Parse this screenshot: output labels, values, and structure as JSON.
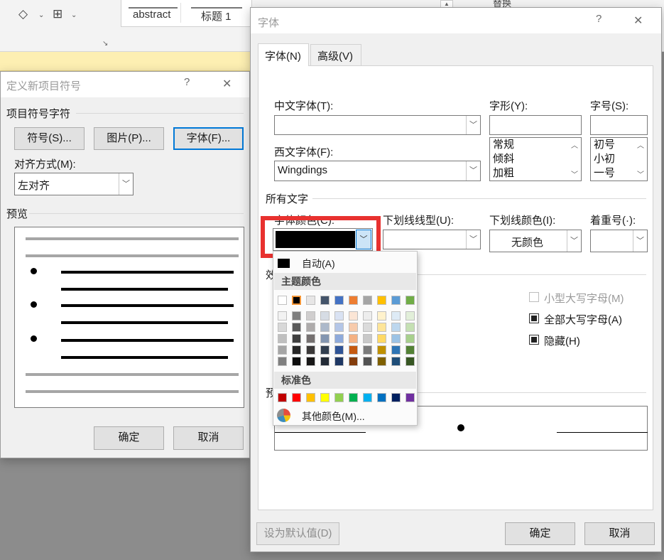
{
  "ribbon": {
    "styles": [
      "abstract",
      "标题 1"
    ],
    "right_label": "替换"
  },
  "bullet_dialog": {
    "title": "定义新项目符号",
    "help": "?",
    "close": "✕",
    "group_label": "项目符号字符",
    "symbol_button": "符号(S)...",
    "picture_button": "图片(P)...",
    "font_button": "字体(F)...",
    "align_label": "对齐方式(M):",
    "align_value": "左对齐",
    "preview_label": "预览",
    "ok": "确定",
    "cancel": "取消"
  },
  "font_dialog": {
    "title": "字体",
    "help": "?",
    "close": "✕",
    "tabs": [
      "字体(N)",
      "高级(V)"
    ],
    "chinese_font_label": "中文字体(T):",
    "chinese_font_value": "",
    "western_font_label": "西文字体(F):",
    "western_font_value": "Wingdings",
    "style_label": "字形(Y):",
    "style_value": "",
    "style_items": [
      "常规",
      "倾斜",
      "加粗"
    ],
    "size_label": "字号(S):",
    "size_value": "",
    "size_items": [
      "初号",
      "小初",
      "一号"
    ],
    "all_text_label": "所有文字",
    "font_color_label": "字体颜色(C):",
    "font_color_value": "#000000",
    "underline_style_label": "下划线线型(U):",
    "underline_style_value": "",
    "underline_color_label": "下划线颜色(I):",
    "underline_color_value": "无颜色",
    "emphasis_label": "着重号(·):",
    "emphasis_value": "",
    "effects_label": "效果",
    "effects": [
      {
        "label": "小型大写字母(M)",
        "checked": false,
        "enabled": false
      },
      {
        "label": "全部大写字母(A)",
        "checked": true,
        "enabled": true
      },
      {
        "label": "隐藏(H)",
        "checked": true,
        "enabled": true
      }
    ],
    "preview_label": "预览",
    "set_default": "设为默认值(D)",
    "ok": "确定",
    "cancel": "取消"
  },
  "color_popup": {
    "auto_label": "自动(A)",
    "theme_header": "主题颜色",
    "standard_header": "标准色",
    "more_colors": "其他颜色(M)...",
    "theme_top": [
      "#ffffff",
      "#000000",
      "#e7e6e6",
      "#44546a",
      "#4472c4",
      "#ed7d31",
      "#a5a5a5",
      "#ffc000",
      "#5b9bd5",
      "#70ad47"
    ],
    "theme_shades": [
      [
        "#f2f2f2",
        "#7f7f7f",
        "#d0cece",
        "#d6dce4",
        "#d9e2f3",
        "#fbe5d5",
        "#ededed",
        "#fff2cc",
        "#deebf6",
        "#e2efd9"
      ],
      [
        "#d8d8d8",
        "#595959",
        "#aeabab",
        "#adb9ca",
        "#b4c6e7",
        "#f7cbac",
        "#dbdbdb",
        "#fee599",
        "#bdd7ee",
        "#c5e0b3"
      ],
      [
        "#bfbfbf",
        "#3f3f3f",
        "#757070",
        "#8496b0",
        "#8eaadb",
        "#f4b183",
        "#c9c9c9",
        "#ffd965",
        "#9cc3e5",
        "#a8d08d"
      ],
      [
        "#a5a5a5",
        "#262626",
        "#3a3838",
        "#323f4f",
        "#2f5496",
        "#c55a11",
        "#7b7b7b",
        "#bf9000",
        "#2e75b5",
        "#538135"
      ],
      [
        "#7f7f7f",
        "#0c0c0c",
        "#171616",
        "#222a35",
        "#1f3864",
        "#833c0b",
        "#525252",
        "#7f6000",
        "#1f4e79",
        "#375623"
      ]
    ],
    "standard": [
      "#c00000",
      "#ff0000",
      "#ffc000",
      "#ffff00",
      "#92d050",
      "#00b050",
      "#00b0f0",
      "#0070c0",
      "#002060",
      "#7030a0"
    ]
  },
  "highlight_color": "#e8312f"
}
